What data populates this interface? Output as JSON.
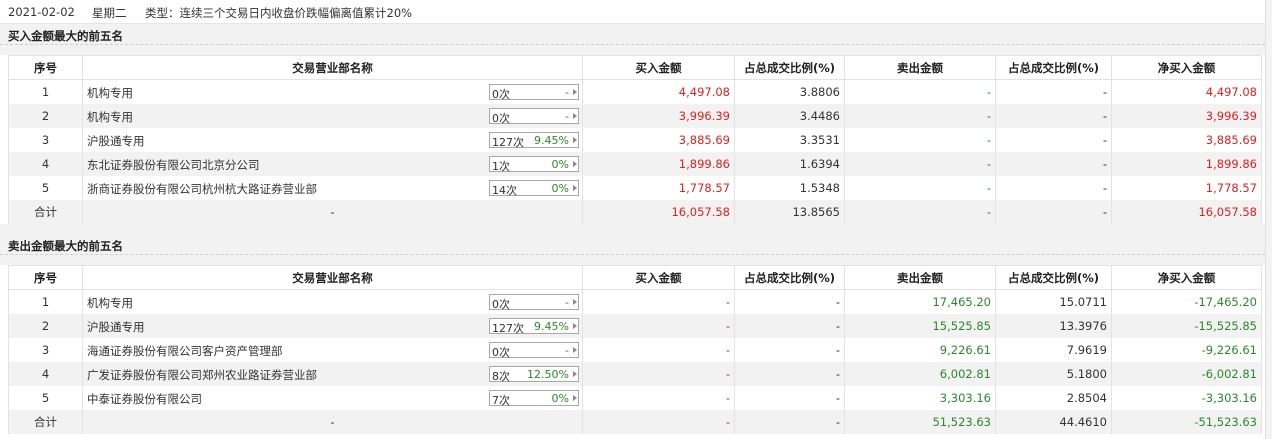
{
  "header": {
    "date": "2021-02-02",
    "weekday": "星期二",
    "type_text": "类型：连续三个交易日内收盘价跌幅偏离值累计20%"
  },
  "columns": [
    "序号",
    "交易营业部名称",
    "买入金额",
    "占总成交比例(%)",
    "卖出金额",
    "占总成交比例(%)",
    "净买入金额"
  ],
  "buy_section": {
    "title": "买入金额最大的前五名",
    "rows": [
      {
        "rank": "1",
        "name": "机构专用",
        "count": "0次",
        "pct": "-",
        "buy": "4,497.08",
        "buy_ratio": "3.8806",
        "sell": "-",
        "sell_ratio": "-",
        "net": "4,497.08"
      },
      {
        "rank": "2",
        "name": "机构专用",
        "count": "0次",
        "pct": "-",
        "buy": "3,996.39",
        "buy_ratio": "3.4486",
        "sell": "-",
        "sell_ratio": "-",
        "net": "3,996.39"
      },
      {
        "rank": "3",
        "name": "沪股通专用",
        "count": "127次",
        "pct": "9.45%",
        "buy": "3,885.69",
        "buy_ratio": "3.3531",
        "sell": "-",
        "sell_ratio": "-",
        "net": "3,885.69"
      },
      {
        "rank": "4",
        "name": "东北证券股份有限公司北京分公司",
        "count": "1次",
        "pct": "0%",
        "buy": "1,899.86",
        "buy_ratio": "1.6394",
        "sell": "-",
        "sell_ratio": "-",
        "net": "1,899.86"
      },
      {
        "rank": "5",
        "name": "浙商证券股份有限公司杭州杭大路证券营业部",
        "count": "14次",
        "pct": "0%",
        "buy": "1,778.57",
        "buy_ratio": "1.5348",
        "sell": "-",
        "sell_ratio": "-",
        "net": "1,778.57"
      }
    ],
    "total": {
      "label": "合计",
      "name": "-",
      "buy": "16,057.58",
      "buy_ratio": "13.8565",
      "sell": "-",
      "sell_ratio": "-",
      "net": "16,057.58"
    }
  },
  "sell_section": {
    "title": "卖出金额最大的前五名",
    "rows": [
      {
        "rank": "1",
        "name": "机构专用",
        "count": "0次",
        "pct": "-",
        "buy": "-",
        "buy_ratio": "-",
        "sell": "17,465.20",
        "sell_ratio": "15.0711",
        "net": "-17,465.20"
      },
      {
        "rank": "2",
        "name": "沪股通专用",
        "count": "127次",
        "pct": "9.45%",
        "buy": "-",
        "buy_ratio": "-",
        "sell": "15,525.85",
        "sell_ratio": "13.3976",
        "net": "-15,525.85"
      },
      {
        "rank": "3",
        "name": "海通证券股份有限公司客户资产管理部",
        "count": "0次",
        "pct": "-",
        "buy": "-",
        "buy_ratio": "-",
        "sell": "9,226.61",
        "sell_ratio": "7.9619",
        "net": "-9,226.61"
      },
      {
        "rank": "4",
        "name": "广发证券股份有限公司郑州农业路证券营业部",
        "count": "8次",
        "pct": "12.50%",
        "buy": "-",
        "buy_ratio": "-",
        "sell": "6,002.81",
        "sell_ratio": "5.1800",
        "net": "-6,002.81"
      },
      {
        "rank": "5",
        "name": "中泰证券股份有限公司",
        "count": "7次",
        "pct": "0%",
        "buy": "-",
        "buy_ratio": "-",
        "sell": "3,303.16",
        "sell_ratio": "2.8504",
        "net": "-3,303.16"
      }
    ],
    "total": {
      "label": "合计",
      "name": "-",
      "buy": "-",
      "buy_ratio": "-",
      "sell": "51,523.63",
      "sell_ratio": "44.4610",
      "net": "-51,523.63"
    }
  },
  "colors": {
    "buy_red": "#e02020",
    "sell_green": "#2a8a2a",
    "stripe": "#f2f2f2"
  }
}
